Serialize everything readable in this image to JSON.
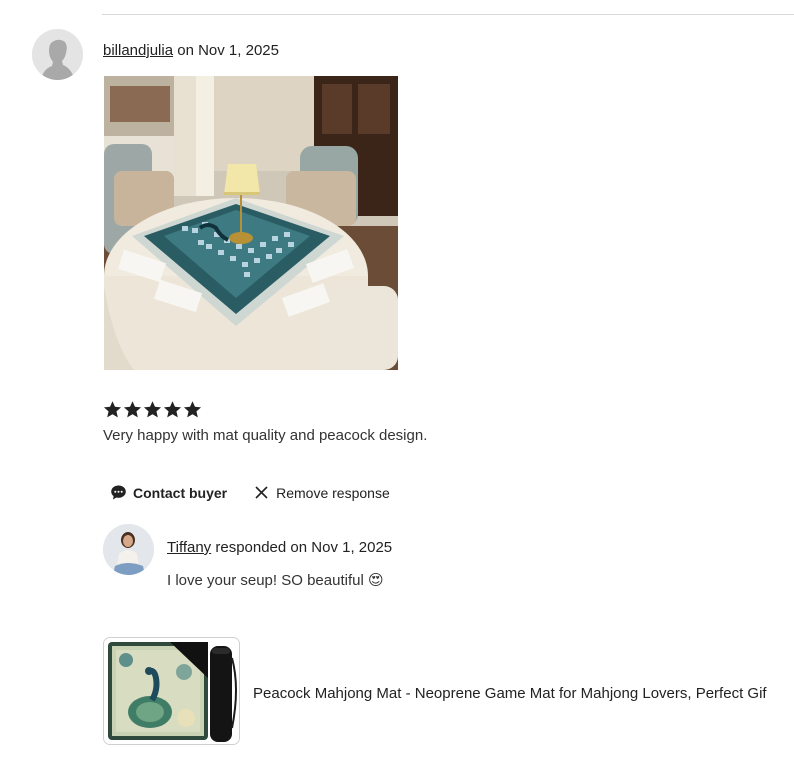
{
  "review": {
    "username": "billandjulia",
    "date_text": " on Nov 1, 2025",
    "rating": 5,
    "text": "Very happy with mat quality and peacock design."
  },
  "actions": {
    "contact_buyer": "Contact buyer",
    "remove_response": "Remove response"
  },
  "response": {
    "username": "Tiffany",
    "date_text": " responded on Nov 1, 2025",
    "text": "I love your seup! SO beautiful 😍"
  },
  "product": {
    "title": "Peacock Mahjong Mat - Neoprene Game Mat for Mahjong Lovers, Perfect Gif"
  },
  "colors": {
    "text": "#222222",
    "divider": "#d9d9d9",
    "star": "#222222"
  },
  "icons": {
    "reviewer_avatar": "person-silhouette-icon",
    "star": "star-icon",
    "contact": "chat-bubble-icon",
    "remove": "close-icon"
  }
}
